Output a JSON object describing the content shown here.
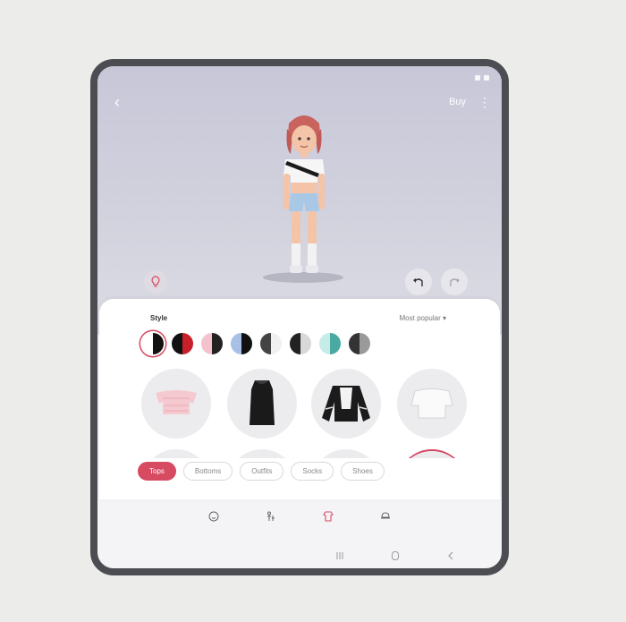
{
  "header": {
    "buy_label": "Buy"
  },
  "panel": {
    "style_label": "Style",
    "sort_label": "Most popular ▾",
    "swatches": [
      {
        "left": "#ffffff",
        "right": "#111111",
        "selected": true
      },
      {
        "left": "#111111",
        "right": "#c8202a",
        "selected": false
      },
      {
        "left": "#f2c3cc",
        "right": "#222222",
        "selected": false
      },
      {
        "left": "#a9c0e6",
        "right": "#111111",
        "selected": false
      },
      {
        "left": "#444444",
        "right": "#f0f0f0",
        "selected": false
      },
      {
        "left": "#222222",
        "right": "#d8d8d8",
        "selected": false
      },
      {
        "left": "#c6ecea",
        "right": "#4aa9a0",
        "selected": false
      },
      {
        "left": "#333333",
        "right": "#9a9a9a",
        "selected": false
      }
    ],
    "tabs": [
      {
        "label": "Tops",
        "active": true
      },
      {
        "label": "Bottoms",
        "active": false
      },
      {
        "label": "Outfits",
        "active": false
      },
      {
        "label": "Socks",
        "active": false
      },
      {
        "label": "Shoes",
        "active": false
      }
    ]
  },
  "icons": {
    "back": "chevron-left-icon",
    "more": "more-vertical-icon",
    "hint": "lightbulb-icon",
    "undo": "undo-icon",
    "redo": "redo-icon",
    "nav": [
      "face-icon",
      "body-icon",
      "clothing-icon",
      "accessories-icon"
    ],
    "system": [
      "recents-icon",
      "home-icon",
      "back-icon"
    ]
  },
  "colors": {
    "accent": "#d64a62",
    "device_frame": "#4b4d52",
    "stage_top": "#c7c7d8"
  }
}
